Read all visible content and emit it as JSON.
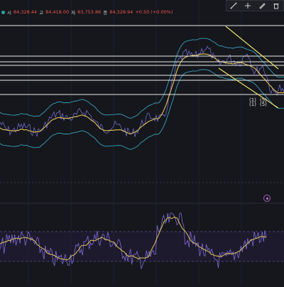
{
  "ohlc": {
    "open_label": "시",
    "open_value": "84,328.44",
    "high_label": "고",
    "high_value": "84,418.00",
    "low_label": "저",
    "low_value": "83,753.86",
    "close_label": "종",
    "close_value": "84,328.94",
    "change": "+0.50 (+0.00%)"
  },
  "toolbar": {
    "icons": [
      "line-tool-icon",
      "crosshair-icon",
      "pencil-icon",
      "trash-icon"
    ]
  },
  "wave_labels": [
    "(1)",
    "(5)",
    "(1)",
    "(5)"
  ],
  "colors": {
    "background": "#15171c",
    "bollinger_band": "#3fb7d8",
    "moving_average": "#e3c15a",
    "price": "#8f84ff",
    "rsi": "#8a74e8",
    "rsi_signal": "#e0c45c",
    "horizontal_level": "#e8e8e8",
    "trend_line": "#e9e26a",
    "marker": "#a65fc0"
  }
}
